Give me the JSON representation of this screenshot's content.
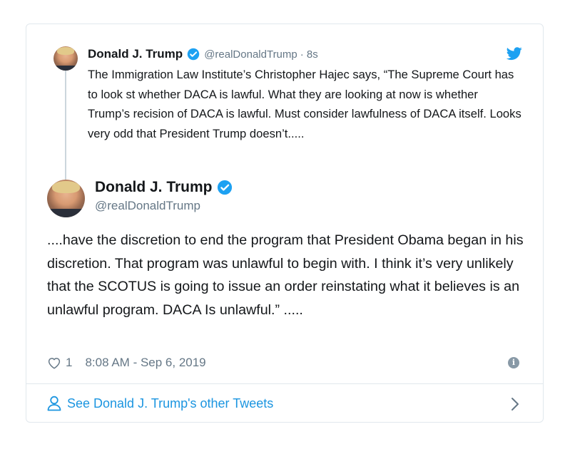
{
  "quoted_tweet": {
    "name": "Donald J. Trump",
    "handle": "@realDonaldTrump",
    "time": "· 8s",
    "text": "The Immigration Law Institute’s Christopher Hajec says, “The Supreme Court has to look st whether DACA is lawful. What they are looking at now is whether Trump’s recision of DACA is lawful. Must consider lawfulness of DACA itself. Looks very odd that President Trump doesn’t....."
  },
  "main_tweet": {
    "name": "Donald J. Trump",
    "handle": "@realDonaldTrump",
    "text": "....have the discretion to end the program that President Obama began in his discretion. That program was unlawful to begin with. I think it’s very unlikely that the SCOTUS is going to issue an order reinstating what it believes is an unlawful program. DACA Is unlawful.” .....",
    "likes": "1",
    "timestamp": "8:08 AM - Sep 6, 2019"
  },
  "footer": {
    "link": "See Donald J. Trump's other Tweets"
  },
  "icons": {
    "brand": "twitter-bird-icon",
    "verified": "verified-badge-icon",
    "like": "heart-icon",
    "info": "info-icon",
    "profile": "person-icon",
    "next": "chevron-right-icon"
  },
  "colors": {
    "twitter_blue": "#1da1f2",
    "link_blue": "#1b95e0",
    "muted_text": "#657786",
    "border": "#e1e8ed"
  }
}
